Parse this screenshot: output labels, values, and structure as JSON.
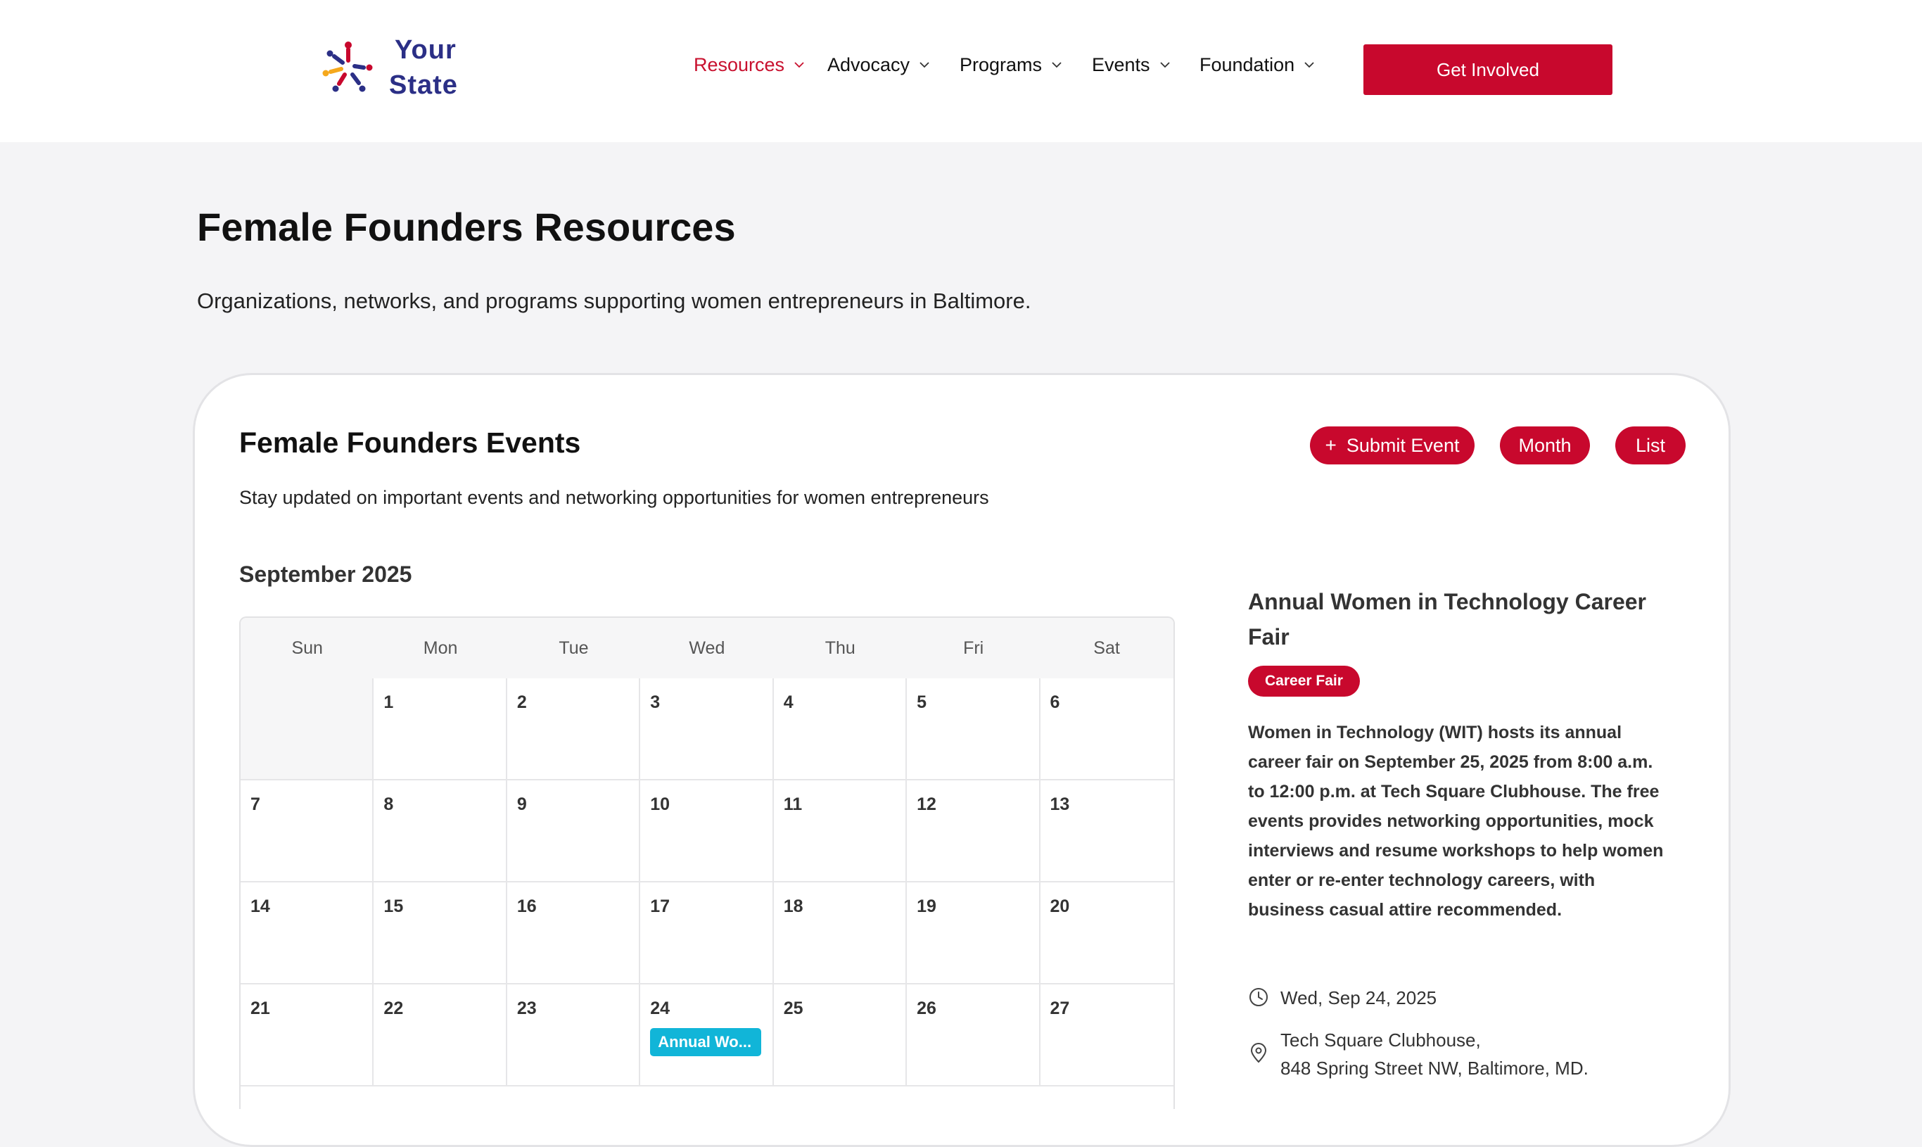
{
  "brand": {
    "line1": "Your",
    "line2": "State"
  },
  "nav": [
    {
      "label": "Resources",
      "active": true
    },
    {
      "label": "Advocacy",
      "active": false
    },
    {
      "label": "Programs",
      "active": false
    },
    {
      "label": "Events",
      "active": false
    },
    {
      "label": "Foundation",
      "active": false
    }
  ],
  "cta_label": "Get Involved",
  "page": {
    "title": "Female Founders Resources",
    "subtitle": "Organizations, networks, and programs supporting women entrepreneurs in Baltimore."
  },
  "events_panel": {
    "title": "Female Founders Events",
    "subtitle": "Stay updated on important events and networking opportunities for women entrepreneurs",
    "actions": {
      "submit_plus": "+",
      "submit": "Submit Event",
      "month": "Month",
      "list": "List"
    }
  },
  "calendar": {
    "month_label": "September 2025",
    "weekdays": [
      "Sun",
      "Mon",
      "Tue",
      "Wed",
      "Thu",
      "Fri",
      "Sat"
    ],
    "days": [
      "",
      "1",
      "2",
      "3",
      "4",
      "5",
      "6",
      "7",
      "8",
      "9",
      "10",
      "11",
      "12",
      "13",
      "14",
      "15",
      "16",
      "17",
      "18",
      "19",
      "20",
      "21",
      "22",
      "23",
      "24",
      "25",
      "26",
      "27"
    ],
    "event_chip": {
      "day": "24",
      "label": "Annual Wo..."
    }
  },
  "event_detail": {
    "title": "Annual Women in Technology Career Fair",
    "tag": "Career Fair",
    "description": "Women in Technology (WIT) hosts its annual career fair on September 25, 2025 from 8:00 a.m. to 12:00 p.m. at Tech Square Clubhouse. The free events provides networking opportunities, mock interviews and resume workshops to help women enter or re-enter technology careers, with business casual attire recommended.",
    "date": "Wed, Sep 24, 2025",
    "location_line1": "Tech Square Clubhouse,",
    "location_line2": "848 Spring Street NW, Baltimore, MD."
  },
  "colors": {
    "brand_red": "#c8082d",
    "brand_navy": "#2b2f86",
    "chip_cyan": "#11b5d8",
    "page_bg": "#f4f4f6"
  },
  "icons": {
    "logo": "starburst-logo-icon",
    "chevron": "chevron-down-icon",
    "clock": "clock-icon",
    "location": "map-pin-icon"
  }
}
